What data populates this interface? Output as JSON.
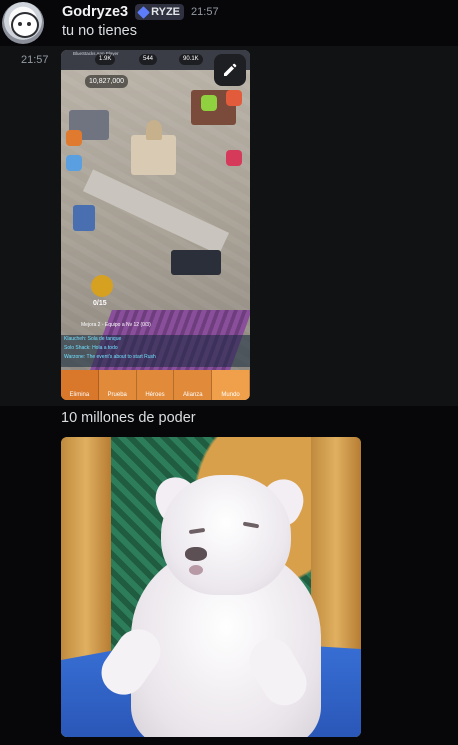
{
  "message": {
    "username": "Godryze3",
    "clan_tag": "RYZE",
    "timestamp": "21:57",
    "text": "tu no tienes",
    "side_timestamp": "21:57",
    "caption": "10 millones de poder"
  },
  "game_screenshot": {
    "window_title": "BlueStacks App Player",
    "resource_1": "1.9K",
    "resource_2": "544",
    "resource_3": "90.1K",
    "power": "10,827,000",
    "progress": "0/15",
    "upgrade_text": "Mejora 2 - Equipo a Nv 12 (0/3)",
    "chat_lines": [
      "Klaucheh: Sola de tanque",
      "Solo Shack: Hola a todo",
      "Warzone: The event's about to start Rush"
    ],
    "tabs": [
      "Elimina",
      "Prueba",
      "Héroes",
      "Alianza",
      "Mundo"
    ]
  },
  "colors": {
    "background": "#070709",
    "hover_row": "#111214",
    "username": "#f2f3f5",
    "text": "#dbdee1",
    "timestamp": "#949ba4"
  }
}
